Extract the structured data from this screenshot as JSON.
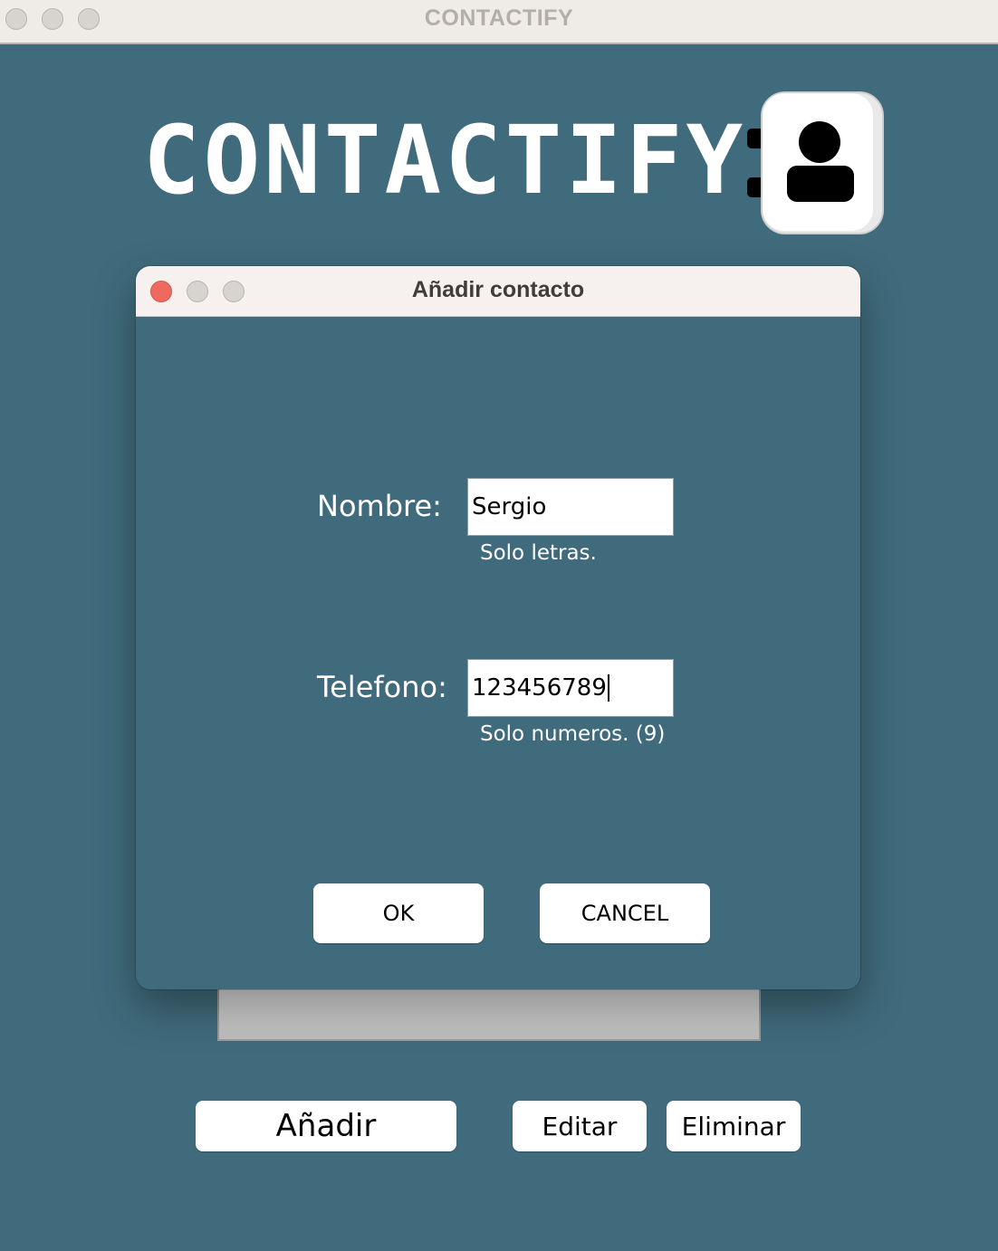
{
  "main_window": {
    "title": "CONTACTIFY",
    "logo_text": "CONTACTIFY",
    "logo_icon": "contact-book-icon",
    "buttons": {
      "add": "Añadir",
      "edit": "Editar",
      "delete": "Eliminar"
    }
  },
  "dialog": {
    "title": "Añadir contacto",
    "fields": {
      "name": {
        "label": "Nombre:",
        "value": "Sergio",
        "hint": "Solo letras."
      },
      "phone": {
        "label": "Telefono:",
        "value": "123456789",
        "hint": "Solo numeros. (9)"
      }
    },
    "buttons": {
      "ok": "OK",
      "cancel": "CANCEL"
    }
  },
  "colors": {
    "background": "#406b7c",
    "titlebar": "#efebe7",
    "close_red": "#ee6a5e"
  }
}
